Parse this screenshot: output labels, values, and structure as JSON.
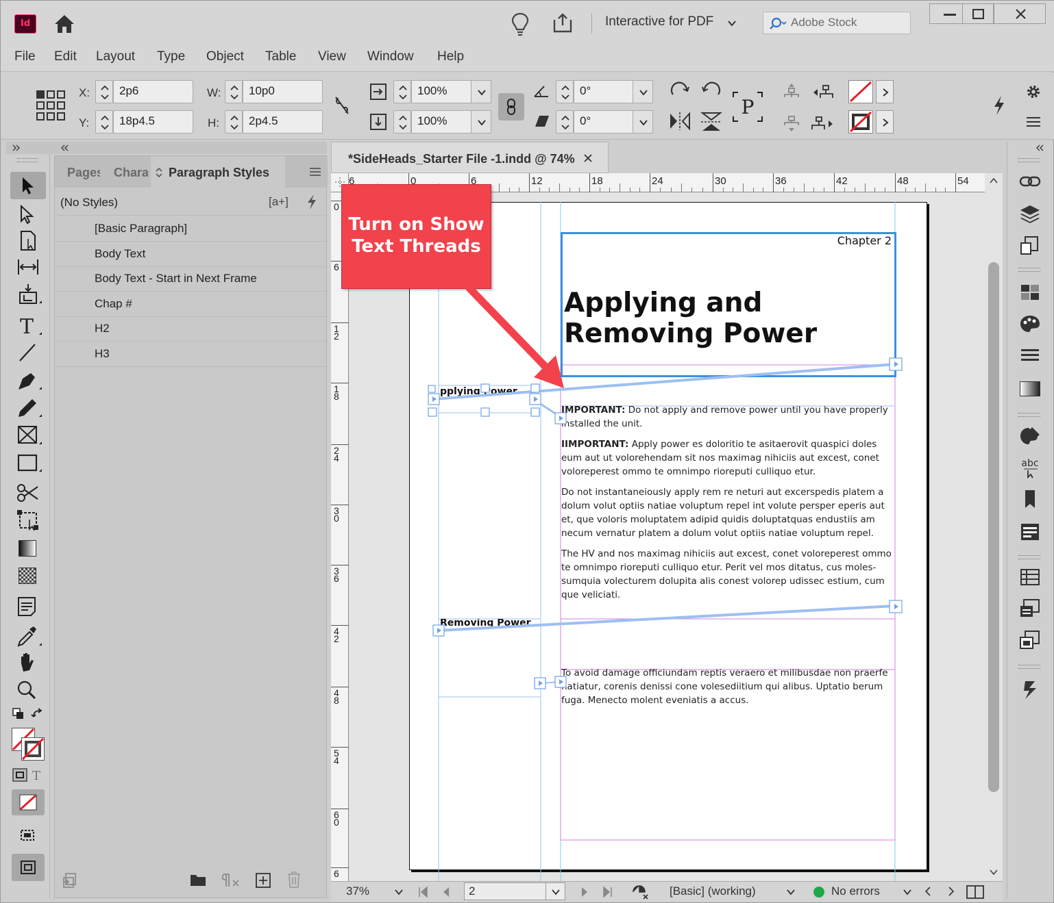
{
  "app": {
    "icon_text": "Id",
    "workspace": "Interactive for PDF",
    "stock_placeholder": "Adobe Stock"
  },
  "menu": [
    "File",
    "Edit",
    "Layout",
    "Type",
    "Object",
    "Table",
    "View",
    "Window",
    "Help"
  ],
  "control": {
    "x_label": "X:",
    "x_value": "2p6",
    "y_label": "Y:",
    "y_value": "18p4.5",
    "w_label": "W:",
    "w_value": "10p0",
    "h_label": "H:",
    "h_value": "2p4.5",
    "scale_x": "100%",
    "scale_y": "100%",
    "rotate": "0°",
    "shear": "0°"
  },
  "panel": {
    "tabs": [
      "Pages",
      "Chara",
      "Paragraph Styles"
    ],
    "no_styles": "(No Styles)",
    "new_style_glyph": "[a+]",
    "styles": [
      "[Basic Paragraph]",
      "Body Text",
      "Body Text - Start in Next Frame",
      "Chap #",
      "H2",
      "H3"
    ]
  },
  "document": {
    "tab_title": "*SideHeads_Starter File -1.indd @ 74%",
    "ruler_h": [
      "6",
      "0",
      "6",
      "12",
      "18",
      "24",
      "30",
      "36",
      "42",
      "48",
      "54"
    ],
    "ruler_v": [
      "0",
      "6",
      "12",
      "18",
      "24",
      "30",
      "36",
      "42",
      "48",
      "54",
      "60",
      "6"
    ],
    "chapter_label": "Chapter 2",
    "title_line1": "Applying and",
    "title_line2": "Removing Power",
    "sidehead1": "pplying Power",
    "sidehead2": "Removing Power",
    "para1_bold": "IMPORTANT:",
    "para1_text": " Do not apply and remove power until you have properly installed the unit.",
    "para2_bold": "IIMPORTANT:",
    "para2_text": " Apply power es doloritio te asitaerovit quaspici doles eum aut ut volorehendam sit nos maximag nihiciis aut excest, conet voloreperest ommo te omnimpo rioreputi culliquo etur.",
    "para3": "Do not  instantaneiously apply rem re neturi aut excerspedis platem a dolum volut optiis natiae voluptum repel int volute persper eperis aut et, que voloris moluptatem adipid quidis doluptatquas endustiis am necum vernatur platem a dolum volut optiis natiae voluptum repel.",
    "para4": "The HV and nos maximag nihiciis aut excest, conet voloreperest ommo te omnimpo rioreputi culliquo etur. Perit vel mos ditatus, cus moles-sumquia volecturem dolupita alis conest volorep udissec estium, cum que veliciati.",
    "para5": "To avoid damage officiundam reptis veraero et milibusdae non praerfe natiatur, corenis denissi cone volesediitium qui alibus. Uptatio berum fuga. Menecto molent eveniatis a accus."
  },
  "status": {
    "zoom": "37%",
    "page": "2",
    "profile": "[Basic] (working)",
    "errors": "No errors"
  },
  "callout": {
    "line1": "Turn on Show",
    "line2": "Text Threads"
  },
  "colors": {
    "callout": "#f2424c",
    "frame_selected": "#3d8fe0",
    "thread": "#9dbff2",
    "margin_guide": "#d47fe0",
    "column_guide": "#7fd0e8",
    "status_ok": "#1ea84a",
    "app_icon_bg": "#49021f",
    "app_icon_fg": "#ff3366"
  },
  "icons": [
    "home-icon",
    "lightbulb-icon",
    "share-icon",
    "search-icon",
    "chevron-down-icon",
    "minimize-icon",
    "maximize-icon",
    "close-icon",
    "reference-point-icon",
    "chain-link-icon",
    "rotate-cw-icon",
    "rotate-ccw-icon",
    "flip-horizontal-icon",
    "flip-vertical-icon",
    "fill-none-icon",
    "stroke-none-icon",
    "lightning-icon",
    "gear-icon",
    "hamburger-menu-icon",
    "selection-tool-icon",
    "direct-selection-icon",
    "page-tool-icon",
    "gap-tool-icon",
    "content-collector-icon",
    "type-tool-icon",
    "line-tool-icon",
    "pen-tool-icon",
    "pencil-tool-icon",
    "rectangle-frame-icon",
    "rectangle-tool-icon",
    "scissors-icon",
    "free-transform-icon",
    "gradient-swatch-icon",
    "gradient-feather-icon",
    "note-tool-icon",
    "eyedropper-icon",
    "hand-tool-icon",
    "zoom-tool-icon",
    "links-icon",
    "layers-icon",
    "pages-icon",
    "swatches-icon",
    "color-icon",
    "stroke-icon",
    "gradient-icon",
    "color-theme-icon",
    "spellcheck-icon",
    "bookmarks-icon",
    "character-styles-icon",
    "table-icon",
    "object-styles-icon",
    "cc-libraries-icon",
    "folder-icon",
    "pilcrow-icon",
    "new-style-icon",
    "trash-icon"
  ]
}
